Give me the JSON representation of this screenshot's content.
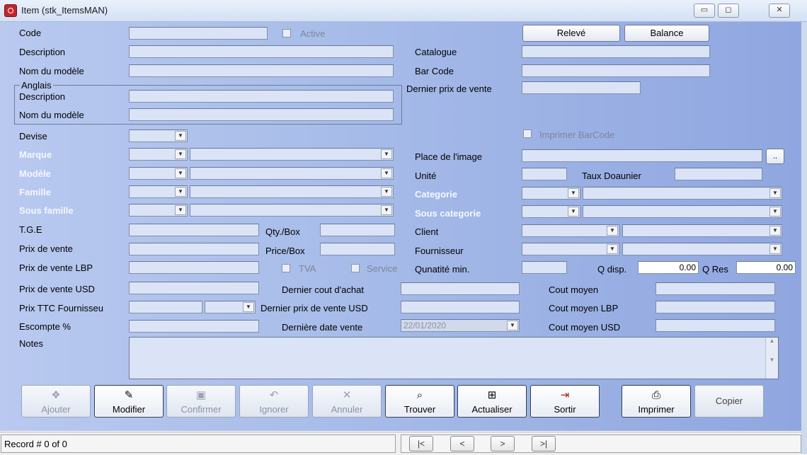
{
  "window": {
    "title": "Item  (stk_ItemsMAN)",
    "minimize": "▭",
    "maximize": "◻",
    "close": "✕"
  },
  "labels": {
    "code": "Code",
    "active": "Active",
    "description": "Description",
    "nom_modele": "Nom du modèle",
    "anglais": "Anglais",
    "anglais_description": "Description",
    "anglais_nom_modele": "Nom du modèle",
    "devise": "Devise",
    "marque": "Marque",
    "modele": "Modèle",
    "famille": "Famille",
    "sous_famille": "Sous famille",
    "tge": "T.G.E",
    "qty_box": "Qty./Box",
    "prix_vente": "Prix de vente",
    "price_box": "Price/Box",
    "prix_vente_lbp": "Prix de vente LBP",
    "tva": "TVA",
    "service": "Service",
    "prix_vente_usd": "Prix de vente USD",
    "dernier_cout_achat": "Dernier cout d'achat",
    "prix_ttc_fournisseur": "Prix TTC Fournisseu",
    "dernier_prix_vente_usd": "Dernier prix de vente USD",
    "escompte": "Escompte %",
    "derniere_date_vente": "Dernière date vente",
    "notes": "Notes",
    "catalogue": "Catalogue",
    "bar_code": "Bar Code",
    "dernier_prix_vente": "Dernier prix de vente",
    "imprimer_barcode": "Imprimer BarCode",
    "place_image": "Place de l'image",
    "unite": "Unité",
    "taux_douanier": "Taux Doaunier",
    "categorie": "Categorie",
    "sous_categorie": "Sous categorie",
    "client": "Client",
    "fournisseur": "Fournisseur",
    "quantite_min": "Qunatité min.",
    "q_disp": "Q disp.",
    "q_res": "Q Res",
    "cout_moyen": "Cout moyen",
    "cout_moyen_lbp": "Cout moyen LBP",
    "cout_moyen_usd": "Cout moyen USD"
  },
  "values": {
    "q_disp": "0.00",
    "q_res": "0.00",
    "derniere_date_vente": "22/01/2020",
    "browse": ".."
  },
  "buttons": {
    "releve": "Relevé",
    "balance": "Balance"
  },
  "toolbar": [
    {
      "label": "Ajouter",
      "icon": "❖"
    },
    {
      "label": "Modifier",
      "icon": "✎"
    },
    {
      "label": "Confirmer",
      "icon": "▣"
    },
    {
      "label": "Ignorer",
      "icon": "↶"
    },
    {
      "label": "Annuler",
      "icon": "✕"
    },
    {
      "label": "Trouver",
      "icon": "⌕"
    },
    {
      "label": "Actualiser",
      "icon": "⊞"
    },
    {
      "label": "Sortir",
      "icon": "⇥"
    },
    {
      "label": "Imprimer",
      "icon": "⎙"
    },
    {
      "label": "Copier",
      "icon": ""
    }
  ],
  "status": {
    "record": "Record #  0 of 0"
  },
  "nav": {
    "first": "|<",
    "prev": "<",
    "next": ">",
    "last": ">|"
  },
  "colors": {
    "form_bg": "#a8bde9",
    "field_bg": "#dbe3f6",
    "white_label": "#f4f7ff"
  }
}
